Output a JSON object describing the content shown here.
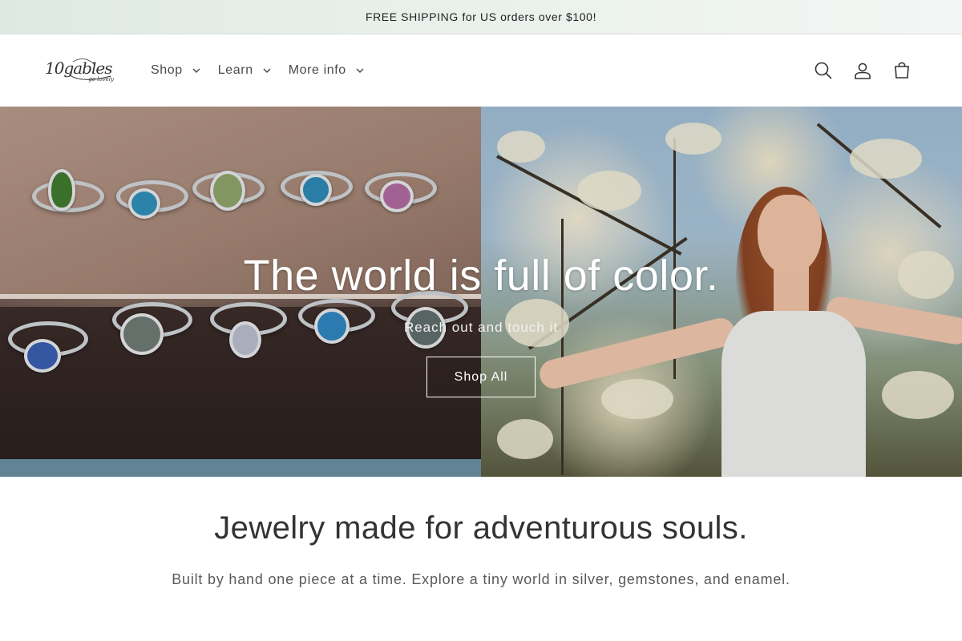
{
  "announcement": {
    "text": "FREE SHIPPING for US orders over $100!"
  },
  "header": {
    "logo": {
      "mark": "10gables",
      "tagline": "go lovely"
    },
    "nav": [
      {
        "label": "Shop",
        "icon": "chevron-down-icon"
      },
      {
        "label": "Learn",
        "icon": "chevron-down-icon"
      },
      {
        "label": "More info",
        "icon": "chevron-down-icon"
      }
    ],
    "icons": [
      "search-icon",
      "account-icon",
      "cart-icon"
    ]
  },
  "hero": {
    "title": "The world is full of color.",
    "subtitle": "Reach out and touch it",
    "button_label": "Shop All"
  },
  "intro": {
    "title": "Jewelry made for adventurous souls.",
    "text": "Built by hand one piece at a time. Explore a tiny world in silver, gemstones, and enamel."
  },
  "colors": {
    "announcement_bg": "#e3ede7",
    "text_dark": "#333333",
    "text_muted": "#5a5a5a",
    "hero_text": "#ffffff"
  }
}
